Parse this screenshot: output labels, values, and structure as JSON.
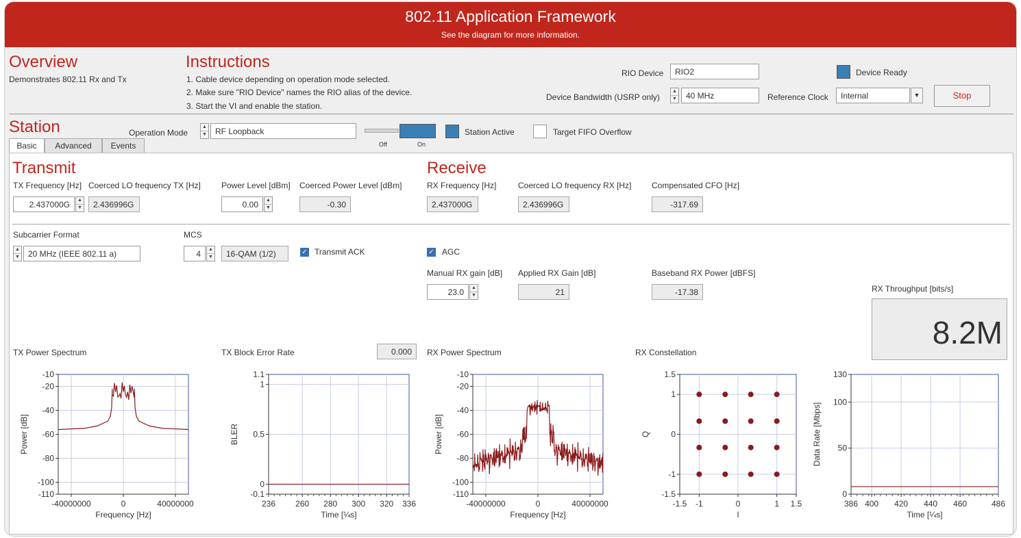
{
  "banner": {
    "title": "802.11 Application Framework",
    "subtitle": "See the diagram for more information."
  },
  "overview": {
    "title": "Overview",
    "text": "Demonstrates 802.11 Rx and Tx"
  },
  "instructions": {
    "title": "Instructions",
    "steps": [
      "1. Cable device depending on operation mode selected.",
      "2. Make sure \"RIO Device\" names the RIO alias of the device.",
      "3. Start the VI and enable the station."
    ]
  },
  "device": {
    "rio_label": "RIO Device",
    "rio_value": "RIO2",
    "ready_label": "Device Ready",
    "bandwidth_label": "Device Bandwidth (USRP only)",
    "bandwidth_value": "40 MHz",
    "refclock_label": "Reference Clock",
    "refclock_value": "Internal",
    "stop_label": "Stop"
  },
  "station": {
    "title": "Station",
    "opmode_label": "Operation Mode",
    "opmode_value": "RF Loopback",
    "switch_off": "Off",
    "switch_on": "On",
    "active_label": "Station Active",
    "fifo_label": "Target FIFO Overflow"
  },
  "tabs": [
    "Basic",
    "Advanced",
    "Events"
  ],
  "transmit": {
    "title": "Transmit",
    "txfreq_label": "TX Frequency [Hz]",
    "txfreq_value": "2.437000G",
    "colo_label": "Coerced LO frequency TX [Hz]",
    "colo_value": "2.436996G",
    "power_label": "Power Level [dBm]",
    "power_value": "0.00",
    "copower_label": "Coerced Power Level [dBm]",
    "copower_value": "-0.30",
    "subcarrier_label": "Subcarrier Format",
    "subcarrier_value": "20 MHz (IEEE 802.11 a)",
    "mcs_label": "MCS",
    "mcs_value": "4",
    "mcs_desc": "16-QAM (1/2)",
    "ack_label": "Transmit ACK"
  },
  "receive": {
    "title": "Receive",
    "rxfreq_label": "RX Frequency [Hz]",
    "rxfreq_value": "2.437000G",
    "colo_label": "Coerced LO frequency RX [Hz]",
    "colo_value": "2.436996G",
    "cfo_label": "Compensated CFO [Hz]",
    "cfo_value": "-317.69",
    "agc_label": "AGC",
    "manual_gain_label": "Manual RX gain [dB]",
    "manual_gain_value": "23.0",
    "applied_gain_label": "Applied RX Gain [dB]",
    "applied_gain_value": "21",
    "bb_power_label": "Baseband RX Power [dBFS]",
    "bb_power_value": "-17.38",
    "throughput_label": "RX Throughput [bits/s]",
    "throughput_value": "8.2M"
  },
  "charts": {
    "tx_spectrum_title": "TX Power Spectrum",
    "tx_bler_title": "TX Block Error Rate",
    "tx_bler_value": "0.000",
    "rx_spectrum_title": "RX Power Spectrum",
    "rx_constellation_title": "RX Constellation"
  },
  "chart_data": [
    {
      "type": "line",
      "title": "TX Power Spectrum",
      "xlabel": "Frequency [Hz]",
      "ylabel": "Power [dB]",
      "xlim": [
        -50000000,
        50000000
      ],
      "ylim": [
        -110,
        -10
      ],
      "xticks": [
        "-40000000",
        "0",
        "40000000"
      ],
      "yticks": [
        "-10",
        "-20",
        "-40",
        "-60",
        "-80",
        "-100",
        "-110"
      ],
      "series": [
        {
          "x": [
            -50000000,
            -30000000,
            -20000000,
            -12000000,
            -10000000,
            -9000000,
            -8500000,
            8500000,
            9000000,
            10000000,
            12000000,
            20000000,
            30000000,
            50000000
          ],
          "y": [
            -56,
            -55,
            -53,
            -49,
            -45,
            -38,
            -22,
            -22,
            -38,
            -45,
            -49,
            -53,
            -55,
            -56
          ]
        }
      ]
    },
    {
      "type": "line",
      "title": "TX Block Error Rate",
      "xlabel": "Time [¼s]",
      "ylabel": "BLER",
      "xlim": [
        236,
        336
      ],
      "ylim": [
        -0.1,
        1.1
      ],
      "xticks": [
        "236",
        "260",
        "280",
        "300",
        "320",
        "336"
      ],
      "yticks": [
        "1.1",
        "1",
        "0.5",
        "0",
        "-0.1"
      ],
      "series": [
        {
          "x": [
            236,
            336
          ],
          "y": [
            0,
            0
          ]
        }
      ]
    },
    {
      "type": "line",
      "title": "RX Power Spectrum",
      "xlabel": "Frequency [Hz]",
      "ylabel": "Power [dB]",
      "xlim": [
        -50000000,
        50000000
      ],
      "ylim": [
        -110,
        -10
      ],
      "xticks": [
        "-40000000",
        "0",
        "40000000"
      ],
      "yticks": [
        "-10",
        "-20",
        "-40",
        "-60",
        "-80",
        "-100",
        "-110"
      ],
      "series": [
        {
          "x": [
            -50000000,
            -30000000,
            -12000000,
            -9000000,
            -8500000,
            8500000,
            9000000,
            12000000,
            30000000,
            50000000
          ],
          "y": [
            -85,
            -78,
            -70,
            -60,
            -38,
            -38,
            -60,
            -70,
            -80,
            -85
          ]
        }
      ]
    },
    {
      "type": "scatter",
      "title": "RX Constellation",
      "xlabel": "I",
      "ylabel": "Q",
      "xlim": [
        -1.5,
        1.5
      ],
      "ylim": [
        -1.5,
        1.5
      ],
      "xticks": [
        "-1.5",
        "-1",
        "0",
        "1",
        "1.5"
      ],
      "yticks": [
        "1.5",
        "1",
        "0",
        "-1",
        "-1.5"
      ],
      "series": [
        {
          "x": [
            -1,
            -0.33,
            0.33,
            1,
            -1,
            -0.33,
            0.33,
            1,
            -1,
            -0.33,
            0.33,
            1,
            -1,
            -0.33,
            0.33,
            1
          ],
          "y": [
            1,
            1,
            1,
            1,
            0.33,
            0.33,
            0.33,
            0.33,
            -0.33,
            -0.33,
            -0.33,
            -0.33,
            -1,
            -1,
            -1,
            -1
          ]
        }
      ]
    },
    {
      "type": "line",
      "title": "",
      "xlabel": "Time [¼s]",
      "ylabel": "Data Rate [Mbps]",
      "xlim": [
        386,
        486
      ],
      "ylim": [
        0,
        130
      ],
      "xticks": [
        "386",
        "400",
        "420",
        "440",
        "460",
        "486"
      ],
      "yticks": [
        "130",
        "100",
        "50",
        "0"
      ],
      "series": [
        {
          "x": [
            386,
            486
          ],
          "y": [
            8.2,
            8.2
          ]
        }
      ]
    }
  ]
}
